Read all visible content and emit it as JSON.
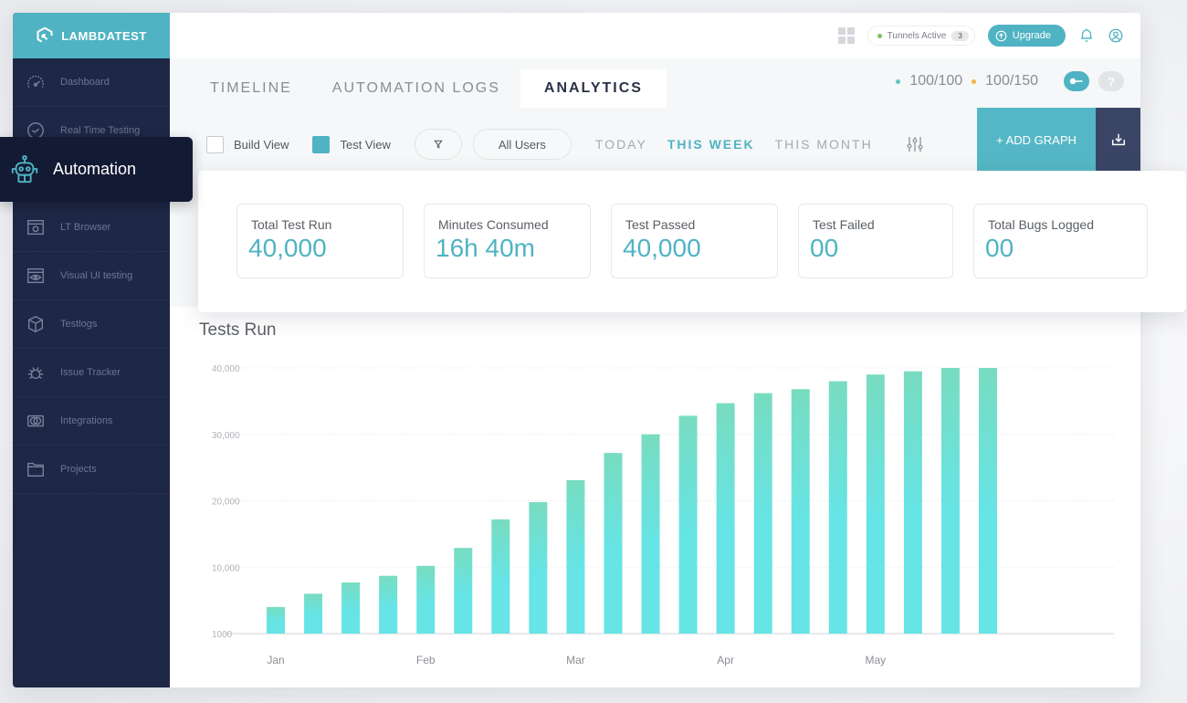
{
  "brand": {
    "name": "LAMBDATEST"
  },
  "sidebar": {
    "items": [
      {
        "label": "Dashboard",
        "icon": "gauge-icon"
      },
      {
        "label": "Real Time Testing",
        "icon": "clock-icon"
      },
      {
        "label": "Automation",
        "icon": "robot-icon",
        "active": true
      },
      {
        "label": "LT Browser",
        "icon": "browser-icon"
      },
      {
        "label": "Visual UI testing",
        "icon": "eye-window-icon"
      },
      {
        "label": "Testlogs",
        "icon": "box-icon"
      },
      {
        "label": "Issue Tracker",
        "icon": "bug-icon"
      },
      {
        "label": "Integrations",
        "icon": "integrations-icon"
      },
      {
        "label": "Projects",
        "icon": "folder-icon"
      }
    ]
  },
  "topbar": {
    "tunnels_label": "Tunnels Active",
    "tunnels_count": "3",
    "upgrade_label": "Upgrade"
  },
  "tabs": [
    {
      "label": "TIMELINE"
    },
    {
      "label": "AUTOMATION LOGS"
    },
    {
      "label": "ANALYTICS",
      "active": true
    }
  ],
  "quota": {
    "first": "100/100",
    "second": "100/150",
    "first_color": "#5cc9c0",
    "second_color": "#f2b544"
  },
  "help_label": "?",
  "filters": {
    "build_view": {
      "label": "Build View",
      "checked": false
    },
    "test_view": {
      "label": "Test View",
      "checked": true
    },
    "users_label": "All Users",
    "ranges": [
      {
        "label": "TODAY"
      },
      {
        "label": "THIS WEEK",
        "active": true
      },
      {
        "label": "THIS MONTH"
      }
    ],
    "add_graph_label": "+ ADD GRAPH"
  },
  "stats": [
    {
      "label": "Total Test Run",
      "value": "40,000"
    },
    {
      "label": "Minutes Consumed",
      "value": "16h 40m"
    },
    {
      "label": "Test Passed",
      "value": "40,000"
    },
    {
      "label": "Test Failed",
      "value": "00"
    },
    {
      "label": "Total Bugs Logged",
      "value": "00"
    }
  ],
  "colors": {
    "accent": "#4fb3c3",
    "sidebar": "#1e2746",
    "bar_top": "#78dcc0",
    "bar_bottom": "#66e4e6"
  },
  "chart_data": {
    "type": "bar",
    "title": "Tests Run",
    "xlabel": "",
    "ylabel": "",
    "ylim": [
      0,
      40000
    ],
    "yticks": [
      {
        "value": 0,
        "label": "1000"
      },
      {
        "value": 10000,
        "label": "10,000"
      },
      {
        "value": 20000,
        "label": "20,000"
      },
      {
        "value": 30000,
        "label": "30,000"
      },
      {
        "value": 40000,
        "label": "40,000"
      }
    ],
    "xtick_labels": [
      {
        "index": 0,
        "label": "Jan"
      },
      {
        "index": 4,
        "label": "Feb"
      },
      {
        "index": 8,
        "label": "Mar"
      },
      {
        "index": 12,
        "label": "Apr"
      },
      {
        "index": 16,
        "label": "May"
      }
    ],
    "grid": true,
    "values": [
      4000,
      6000,
      7700,
      8700,
      10200,
      12900,
      17200,
      19800,
      23100,
      27200,
      30000,
      32800,
      34700,
      36200,
      36800,
      38000,
      39000,
      39500,
      40000,
      40000
    ]
  }
}
